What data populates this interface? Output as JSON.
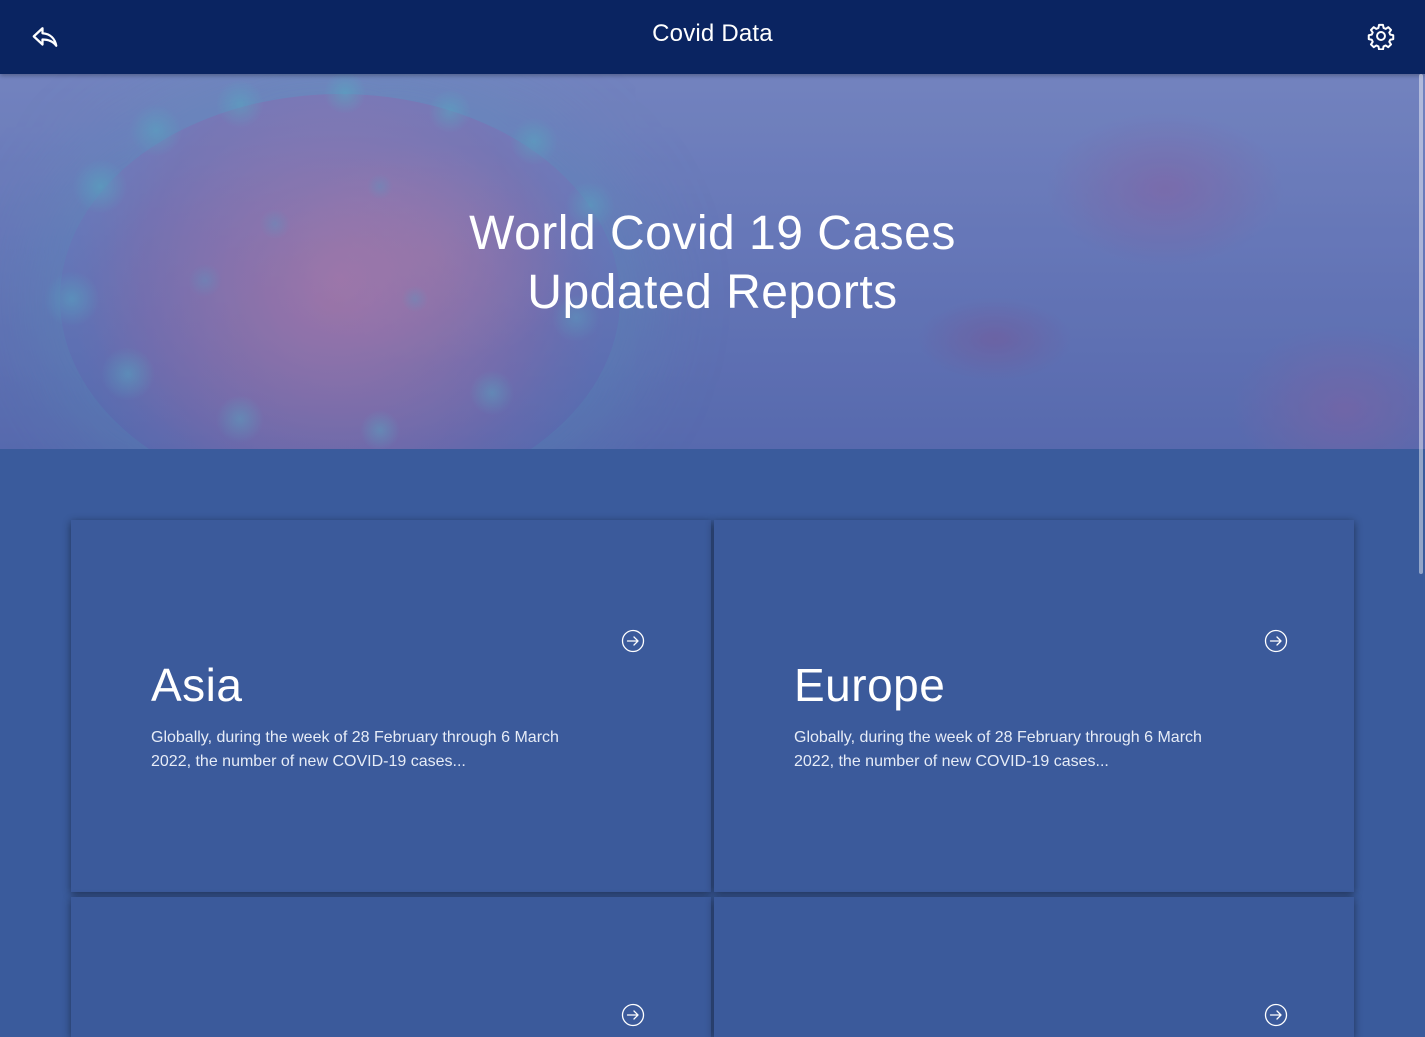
{
  "app_bar": {
    "title": "Covid Data",
    "back_icon": "reply-back-icon",
    "settings_icon": "gear-icon",
    "background": "#0a2461"
  },
  "hero": {
    "line1": "World Covid 19 Cases",
    "line2": "Updated Reports"
  },
  "cards": [
    {
      "region": "Asia",
      "description": "Globally, during the week of 28 February through 6 March 2022, the number of new COVID-19 cases...",
      "icon": "arrow-circle-right-icon"
    },
    {
      "region": "Europe",
      "description": "Globally, during the week of 28 February through 6 March 2022, the number of new COVID-19 cases...",
      "icon": "arrow-circle-right-icon"
    },
    {
      "region": "",
      "description": "",
      "icon": "arrow-circle-right-icon"
    },
    {
      "region": "",
      "description": "",
      "icon": "arrow-circle-right-icon"
    }
  ],
  "colors": {
    "page_background": "#3a5b9c",
    "card_background": "#3b5a9b",
    "text": "#ffffff"
  }
}
